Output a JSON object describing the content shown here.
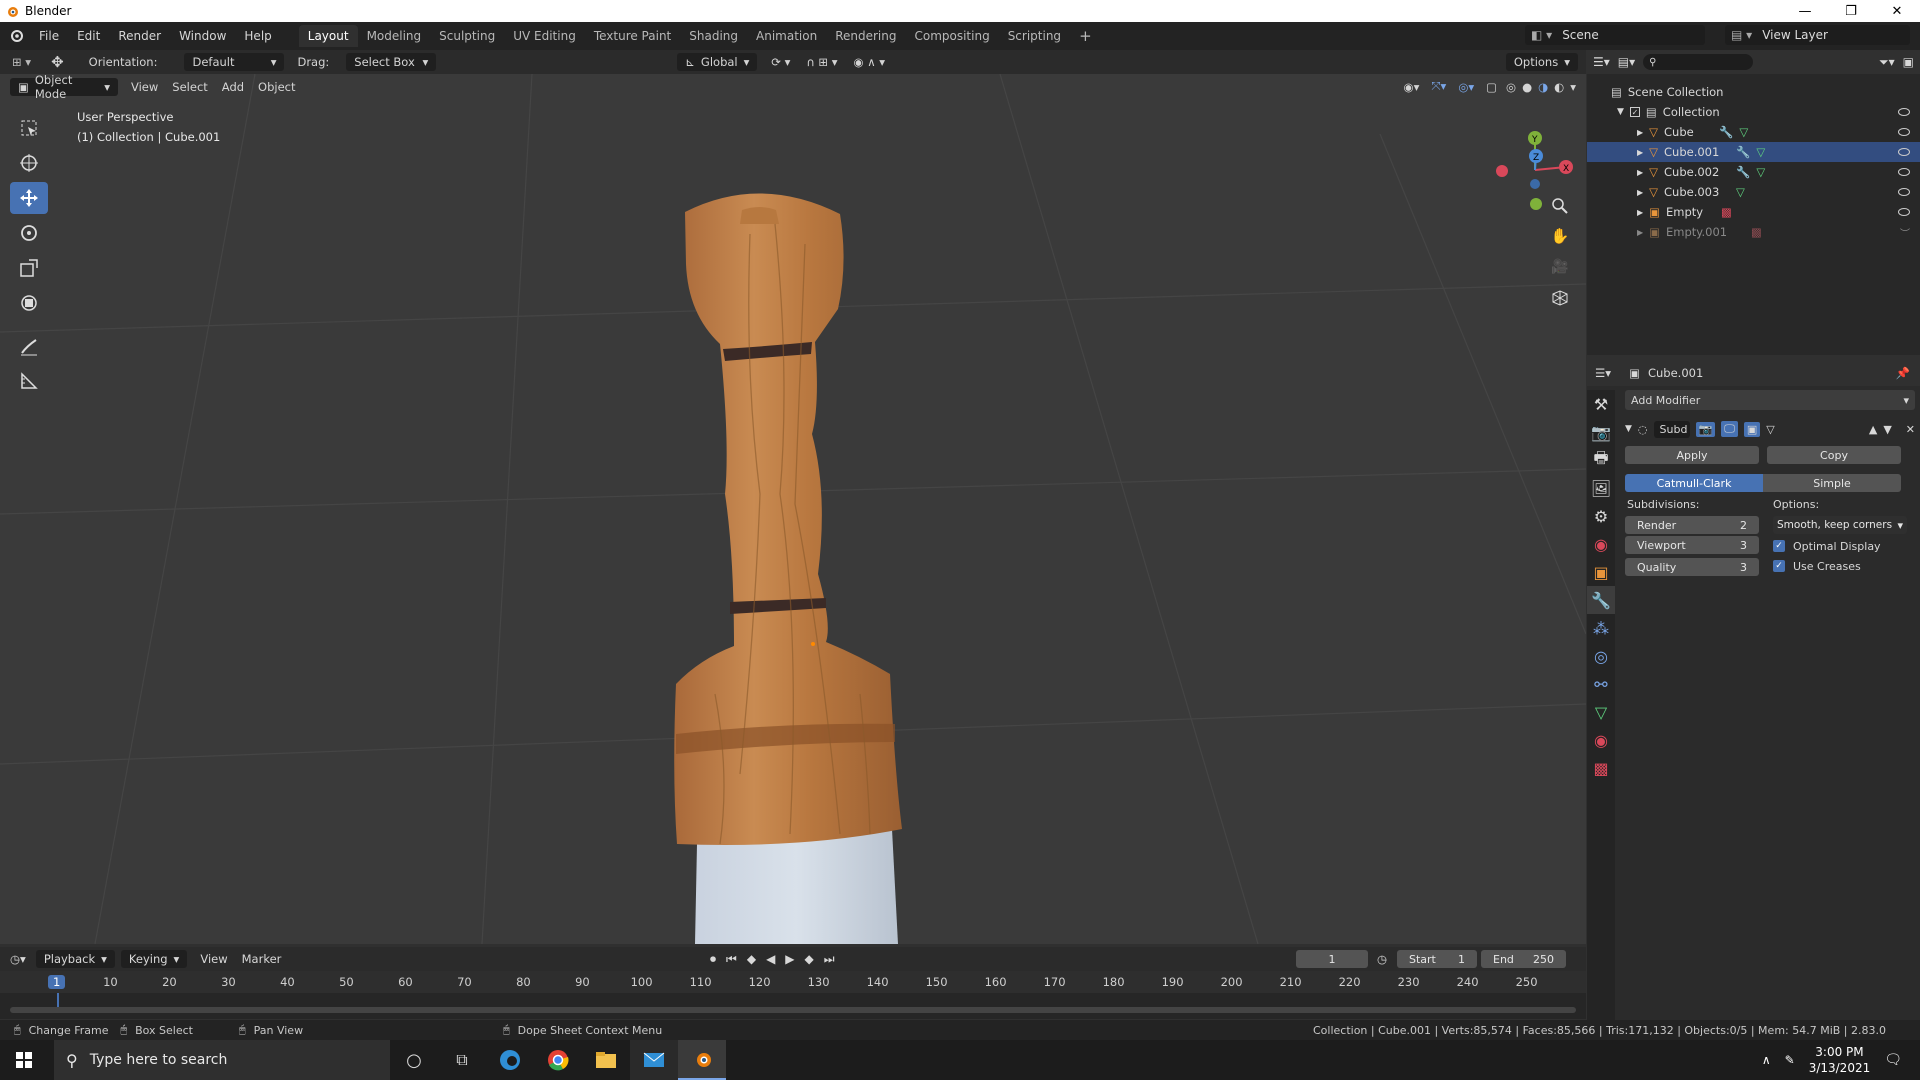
{
  "window": {
    "title": "Blender",
    "min": "—",
    "max": "❐",
    "close": "✕"
  },
  "menus": [
    "File",
    "Edit",
    "Render",
    "Window",
    "Help"
  ],
  "workspaces": [
    "Layout",
    "Modeling",
    "Sculpting",
    "UV Editing",
    "Texture Paint",
    "Shading",
    "Animation",
    "Rendering",
    "Compositing",
    "Scripting"
  ],
  "workspace_add": "+",
  "scene": "Scene",
  "view_layer": "View Layer",
  "header": {
    "orientation_label": "Orientation:",
    "orientation_value": "Default",
    "drag_label": "Drag:",
    "drag_value": "Select Box",
    "transform": "Global",
    "options": "Options"
  },
  "viewport_header": {
    "mode": "Object Mode",
    "menus": [
      "View",
      "Select",
      "Add",
      "Object"
    ]
  },
  "viewport": {
    "perspective": "User Perspective",
    "collection_info": "(1) Collection | Cube.001"
  },
  "gizmo": {
    "y": "Y",
    "z": "Z",
    "x": "X"
  },
  "outliner": {
    "root": "Scene Collection",
    "collection": "Collection",
    "items": [
      {
        "name": "Cube",
        "type": "mesh"
      },
      {
        "name": "Cube.001",
        "type": "mesh"
      },
      {
        "name": "Cube.002",
        "type": "mesh"
      },
      {
        "name": "Cube.003",
        "type": "mesh"
      },
      {
        "name": "Empty",
        "type": "empty"
      },
      {
        "name": "Empty.001",
        "type": "empty"
      }
    ]
  },
  "properties": {
    "object": "Cube.001",
    "add_modifier": "Add Modifier",
    "modifier_name": "Subd",
    "apply": "Apply",
    "copy": "Copy",
    "catmull": "Catmull-Clark",
    "simple": "Simple",
    "subdivisions_label": "Subdivisions:",
    "render_label": "Render",
    "render_value": "2",
    "viewport_label": "Viewport",
    "viewport_value": "3",
    "quality_label": "Quality",
    "quality_value": "3",
    "options_label": "Options:",
    "uv_smooth": "Smooth, keep corners",
    "optimal_display": "Optimal Display",
    "use_creases": "Use Creases"
  },
  "timeline": {
    "menus": [
      "Playback",
      "Keying",
      "View",
      "Marker"
    ],
    "current_frame": "1",
    "start_label": "Start",
    "start": "1",
    "end_label": "End",
    "end": "250",
    "ticks": [
      "1",
      "10",
      "20",
      "30",
      "40",
      "50",
      "60",
      "70",
      "80",
      "90",
      "100",
      "110",
      "120",
      "130",
      "140",
      "150",
      "160",
      "170",
      "180",
      "190",
      "200",
      "210",
      "220",
      "230",
      "240",
      "250"
    ]
  },
  "statusbar": {
    "change_frame": "Change Frame",
    "box_select": "Box Select",
    "pan_view": "Pan View",
    "context_menu": "Dope Sheet Context Menu",
    "stats": "Collection | Cube.001 | Verts:85,574 | Faces:85,566 | Tris:171,132 | Objects:0/5 | Mem: 54.7 MiB | 2.83.0"
  },
  "taskbar": {
    "search_placeholder": "Type here to search",
    "time": "3:00 PM",
    "date": "3/13/2021"
  }
}
